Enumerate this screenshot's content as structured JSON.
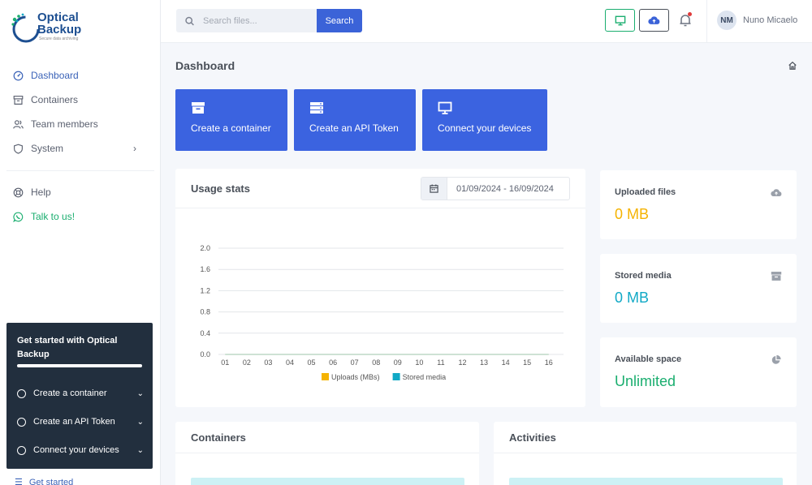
{
  "brand": {
    "line1": "Optical",
    "line2": "Backup",
    "tagline": "Secure data archiving"
  },
  "sidebar": {
    "items": [
      {
        "label": "Dashboard",
        "icon": "dashboard-icon"
      },
      {
        "label": "Containers",
        "icon": "archive-icon"
      },
      {
        "label": "Team members",
        "icon": "users-icon"
      },
      {
        "label": "System",
        "icon": "shield-icon"
      }
    ],
    "secondary": [
      {
        "label": "Help",
        "icon": "lifebuoy-icon"
      },
      {
        "label": "Talk to us!",
        "icon": "whatsapp-icon"
      }
    ],
    "get_started": {
      "title": "Get started with Optical Backup",
      "progress": 1.0,
      "steps": [
        "Create a container",
        "Create an API Token",
        "Connect your devices"
      ],
      "footer_label": "Get started"
    }
  },
  "topbar": {
    "search_placeholder": "Search files...",
    "search_button": "Search",
    "user_initials": "NM",
    "user_name": "Nuno Micaelo"
  },
  "page": {
    "title": "Dashboard"
  },
  "actions": [
    {
      "label": "Create a container",
      "icon": "archive-icon"
    },
    {
      "label": "Create an API Token",
      "icon": "server-icon"
    },
    {
      "label": "Connect your devices",
      "icon": "monitor-icon"
    }
  ],
  "usage": {
    "title": "Usage stats",
    "date_range": "01/09/2024 - 16/09/2024"
  },
  "chart_data": {
    "type": "line",
    "categories": [
      "01",
      "02",
      "03",
      "04",
      "05",
      "06",
      "07",
      "08",
      "09",
      "10",
      "11",
      "12",
      "13",
      "14",
      "15",
      "16"
    ],
    "series": [
      {
        "name": "Uploads (MBs)",
        "color": "#f5b301",
        "values": [
          0,
          0,
          0,
          0,
          0,
          0,
          0,
          0,
          0,
          0,
          0,
          0,
          0,
          0,
          0,
          0
        ]
      },
      {
        "name": "Stored media",
        "color": "#11a9c6",
        "values": [
          0,
          0,
          0,
          0,
          0,
          0,
          0,
          0,
          0,
          0,
          0,
          0,
          0,
          0,
          0,
          0
        ]
      }
    ],
    "y_ticks": [
      "2.0",
      "1.6",
      "1.2",
      "0.8",
      "0.4",
      "0.0"
    ],
    "ylim": [
      0,
      2.0
    ],
    "grid": true,
    "legend": "bottom-center"
  },
  "stats": [
    {
      "title": "Uploaded files",
      "value": "0 MB",
      "color": "#f5b301",
      "icon": "cloud-upload-icon"
    },
    {
      "title": "Stored media",
      "value": "0 MB",
      "color": "#11a9c6",
      "icon": "archive-icon"
    },
    {
      "title": "Available space",
      "value": "Unlimited",
      "color": "#1aae6f",
      "icon": "pie-chart-icon"
    }
  ],
  "bottom": {
    "containers_title": "Containers",
    "activities_title": "Activities"
  }
}
